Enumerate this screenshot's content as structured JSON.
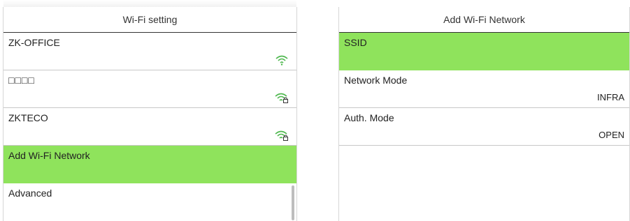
{
  "left_panel": {
    "title": "Wi-Fi setting",
    "items": [
      {
        "label": "ZK-OFFICE",
        "icon": "wifi-icon"
      },
      {
        "label": "□□□□",
        "icon": "wifi-locked-icon"
      },
      {
        "label": "ZKTECO",
        "icon": "wifi-locked-icon"
      },
      {
        "label": "Add Wi-Fi Network"
      },
      {
        "label": "Advanced"
      }
    ]
  },
  "right_panel": {
    "title": "Add Wi-Fi Network",
    "items": [
      {
        "label": "SSID",
        "value": ""
      },
      {
        "label": "Network Mode",
        "value": "INFRA"
      },
      {
        "label": "Auth. Mode",
        "value": "OPEN"
      }
    ]
  },
  "colors": {
    "selected": "#8fe35c",
    "wifi_icon": "#4fb84f"
  }
}
